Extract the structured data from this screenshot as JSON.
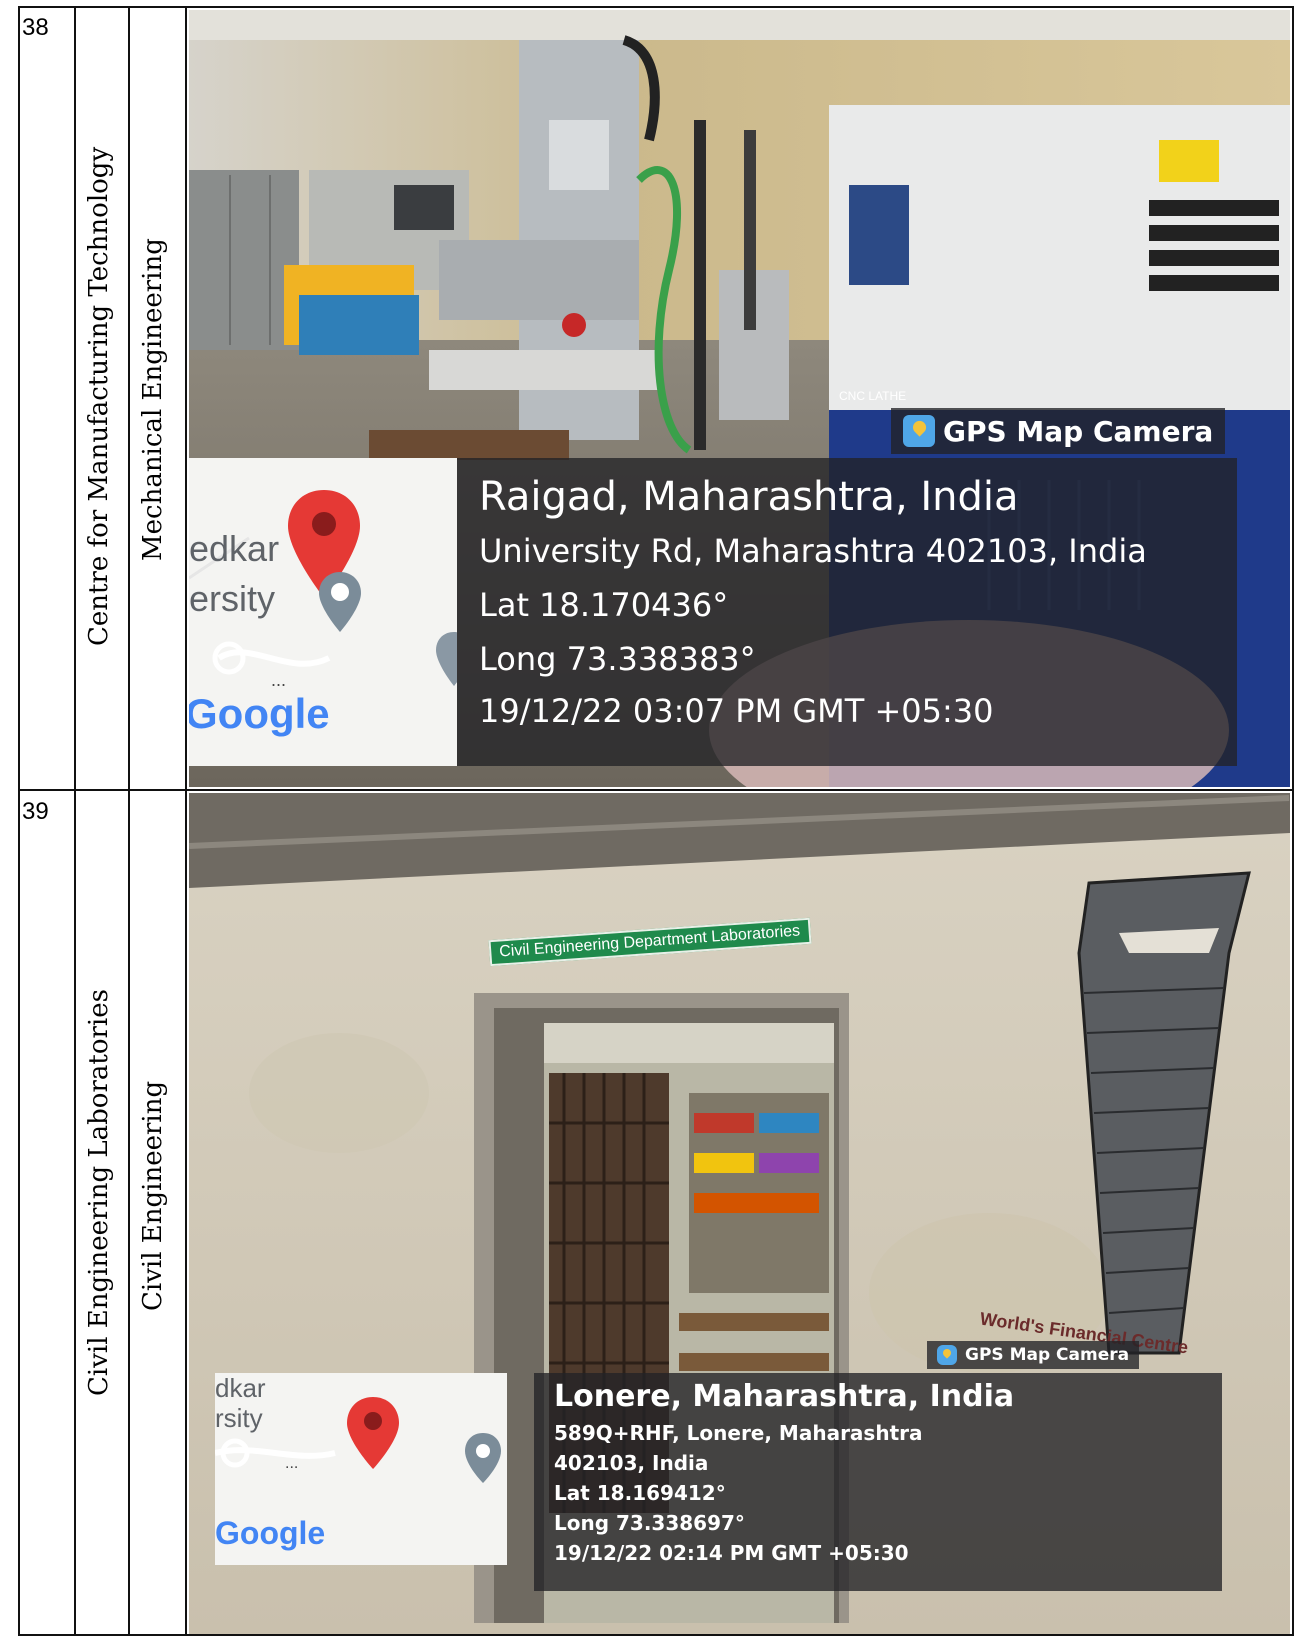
{
  "rows": [
    {
      "number": "38",
      "facility": "Centre for Manufacturing Technology",
      "department": "Mechanical Engineering",
      "photo": {
        "badge": "GPS Map Camera",
        "location": "Raigad, Maharashtra, India",
        "address_lines": [
          "University Rd, Maharashtra 402103, India"
        ],
        "lat": "Lat 18.170436°",
        "long": "Long 73.338383°",
        "timestamp": "19/12/22 03:07 PM GMT +05:30",
        "map_labels": [
          "edkar",
          "ersity"
        ],
        "map_dots": "...",
        "map_logo": "Google",
        "equipment_label": "CNC LATHE"
      }
    },
    {
      "number": "39",
      "facility": "Civil Engineering Laboratories",
      "department": "Civil Engineering",
      "photo": {
        "badge": "GPS Map Camera",
        "location": "Lonere, Maharashtra, India",
        "address_lines": [
          "589Q+RHF, Lonere, Maharashtra",
          "402103, India"
        ],
        "lat": "Lat 18.169412°",
        "long": "Long 73.338697°",
        "timestamp": "19/12/22 02:14 PM GMT +05:30",
        "map_labels": [
          "dkar",
          "rsity"
        ],
        "map_dots": "...",
        "map_logo": "Google",
        "sign_text": "Civil Engineering Department Laboratories",
        "wall_text": "World's Financial Centre"
      }
    }
  ],
  "colors": {
    "overlay": "#232326",
    "pin_red": "#e53935",
    "sign_green": "#1f8a4c"
  }
}
